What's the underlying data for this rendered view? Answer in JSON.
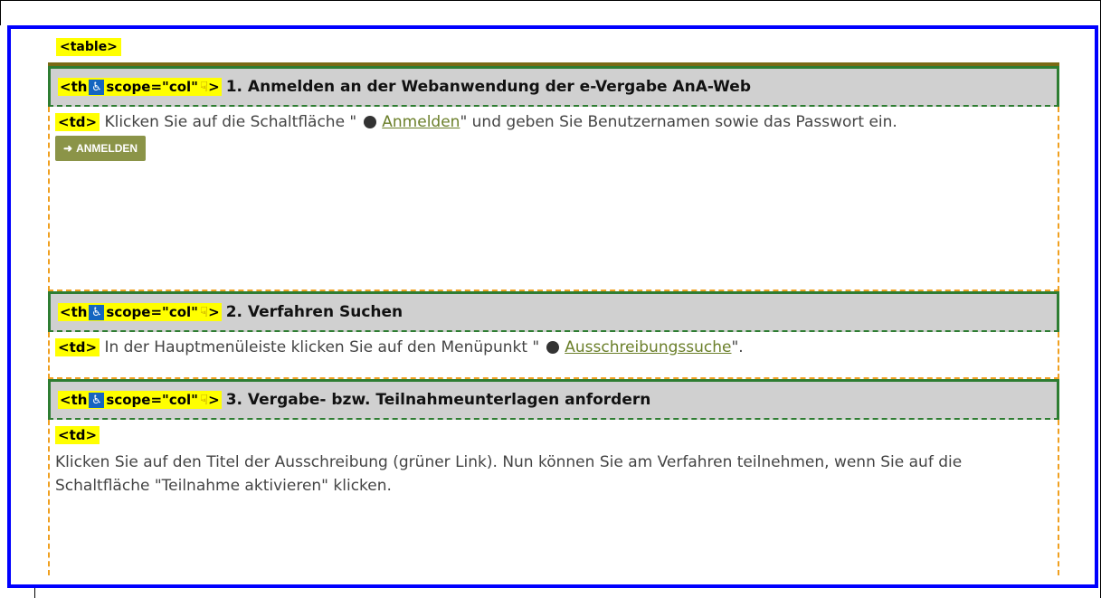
{
  "table_tag": "<table>",
  "rows": [
    {
      "th_open": "<th",
      "th_attr": " scope=\"col\"",
      "th_close": ">",
      "heading": "1. Anmelden an der Webanwendung der e-Vergabe AnA-Web",
      "td_tag": "<td>",
      "text_before": "Klicken Sie auf die Schaltfläche \"",
      "link": "Anmelden",
      "text_after": "\" und geben Sie Benutzernamen sowie das Passwort ein.",
      "button_label": "ANMELDEN"
    },
    {
      "th_open": "<th",
      "th_attr": " scope=\"col\"",
      "th_close": ">",
      "heading": "2. Verfahren Suchen",
      "td_tag": "<td>",
      "text_before": "In der Hauptmenüleiste klicken Sie auf den Menüpunkt \"",
      "link": "Ausschreibungssuche",
      "text_after": "\"."
    },
    {
      "th_open": "<th",
      "th_attr": " scope=\"col\"",
      "th_close": ">",
      "heading": "3. Vergabe- bzw. Teilnahmeunterlagen anfordern",
      "td_tag": "<td>",
      "text": "Klicken Sie auf den Titel der Ausschreibung (grüner Link). Nun können Sie am Verfahren teilnehmen, wenn Sie auf die Schaltfläche \"Teilnahme aktivieren\" klicken."
    }
  ],
  "icons": {
    "accessibility": "wheelchair-icon",
    "pointer": "pointing-hand-icon",
    "button": "circle-arrow-icon",
    "login": "login-arrow-icon"
  },
  "colors": {
    "highlight": "#ffff00",
    "focus_outline": "#0000ff",
    "th_border": "#2e7d32",
    "td_border": "#f0a020",
    "link": "#6b7f2a",
    "button_bg": "#8b9448"
  }
}
